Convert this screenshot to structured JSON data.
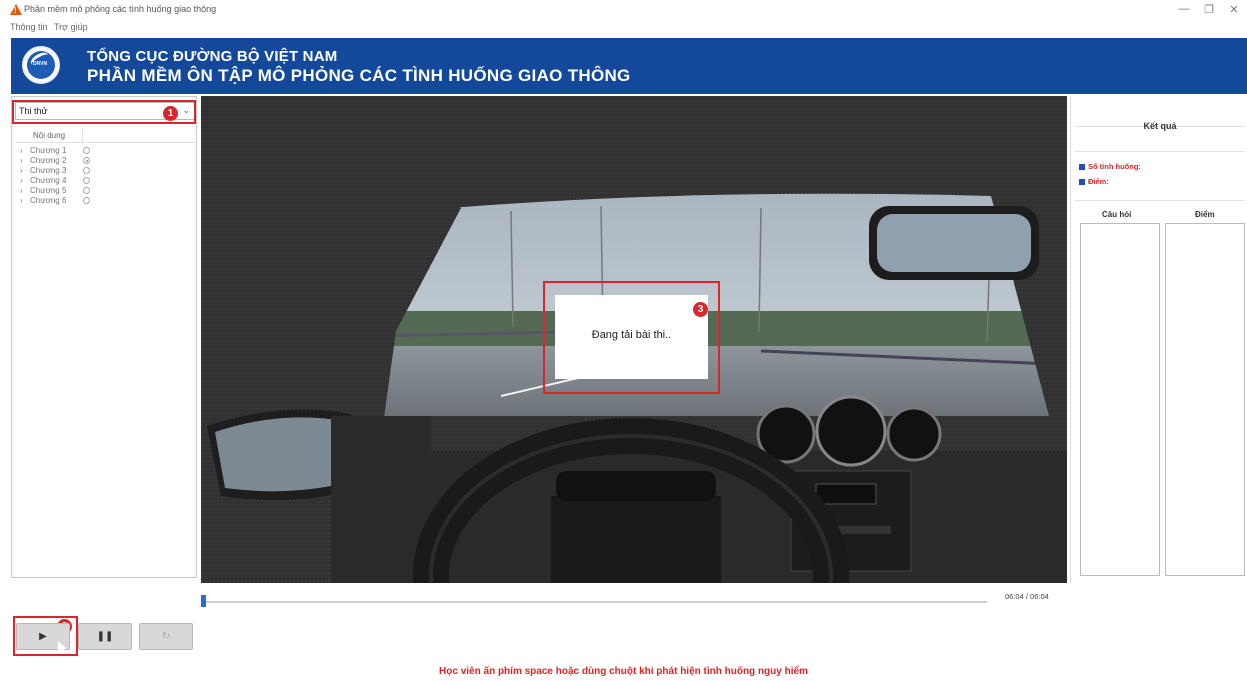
{
  "window": {
    "title": "Phần mềm mô phỏng các tình huống giao thông",
    "icon": "warning-triangle-icon",
    "controls": {
      "minimize": "—",
      "restore": "❐",
      "close": "✕"
    }
  },
  "menu": {
    "items": [
      "Thông tin",
      "Trợ giúp"
    ]
  },
  "header": {
    "logo_text": "DRVN",
    "line1": "TỔNG CỤC ĐƯỜNG BỘ VIỆT NAM",
    "line2": "PHẦN MỀM ÔN TẬP MÔ PHỎNG CÁC TÌNH HUỐNG GIAO THÔNG",
    "bg_color": "#14489a"
  },
  "left_panel": {
    "mode_select": {
      "value": "Thi thử"
    },
    "tree_header": "Nội dung",
    "chapters": [
      {
        "label": "Chương 1",
        "selected": false
      },
      {
        "label": "Chương 2",
        "selected": true
      },
      {
        "label": "Chương 3",
        "selected": false
      },
      {
        "label": "Chương 4",
        "selected": false
      },
      {
        "label": "Chương 5",
        "selected": false
      },
      {
        "label": "Chương 6",
        "selected": false
      }
    ]
  },
  "video": {
    "loading_text": "Đang tải bài thi.."
  },
  "annotations": {
    "one": "1",
    "two": "2",
    "three": "3",
    "color": "#d9262b"
  },
  "right_panel": {
    "result_title": "Kết quả",
    "situations_label": "Số tình huống:",
    "score_label": "Điểm:",
    "col_question": "Câu hỏi",
    "col_score": "Điểm"
  },
  "player": {
    "time": "06:04 / 06:04",
    "progress": 0.0,
    "play_label": "▶",
    "pause_label": "❚❚",
    "replay_icon": "replay-icon"
  },
  "footer": {
    "message": "Học viên ấn phím space hoặc dùng chuột khi phát hiện tình huống nguy hiểm"
  }
}
